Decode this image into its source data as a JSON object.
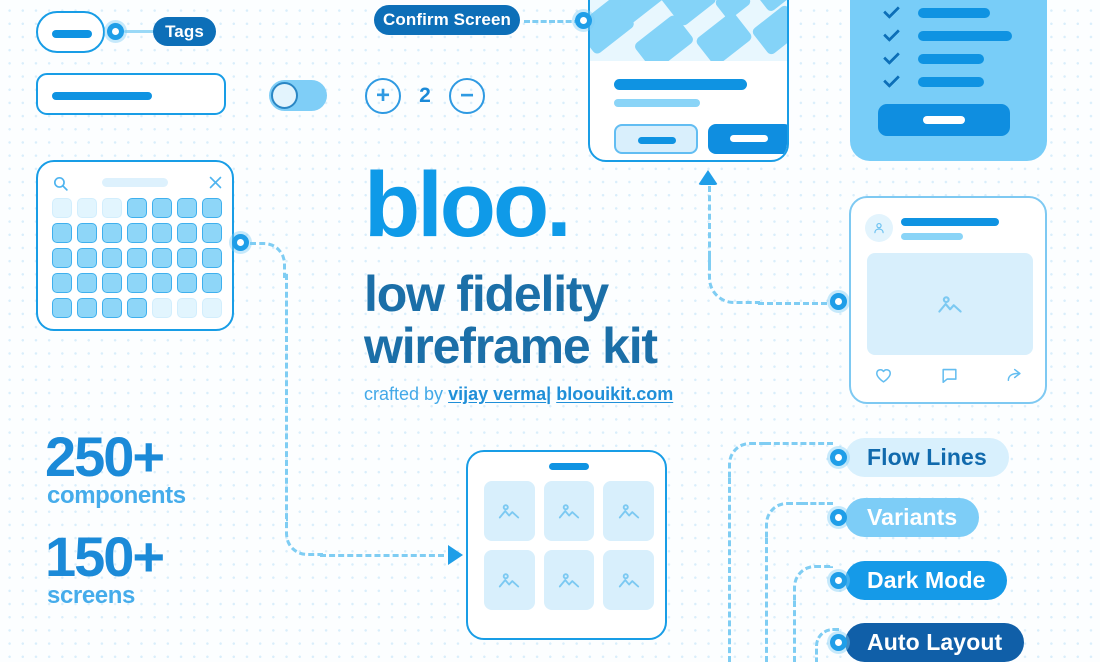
{
  "page": {
    "background": "#fcfeff",
    "accent_bright": "#0f9ae8",
    "accent_dark": "#1b6fa8",
    "accent_light": "#8ad4f7"
  },
  "brand": {
    "logo": "bloo.",
    "headline_line1": "low fidelity",
    "headline_line2": "wireframe kit",
    "credit_prefix": "crafted by",
    "credit_author": "vijay verma",
    "credit_separator": "|",
    "credit_site": "bloouikit.com"
  },
  "stats": [
    {
      "number": "250+",
      "label": "components"
    },
    {
      "number": "150+",
      "label": "screens"
    }
  ],
  "annotations": {
    "tags": "Tags",
    "confirm_screen": "Confirm Screen"
  },
  "feature_pills": [
    {
      "label": "Flow Lines",
      "style": "pale",
      "color": "#d8f0fd"
    },
    {
      "label": "Variants",
      "style": "mid",
      "color": "#7dcdf7"
    },
    {
      "label": "Dark Mode",
      "style": "bright",
      "color": "#159ae8"
    },
    {
      "label": "Auto Layout",
      "style": "navy",
      "color": "#105fa8"
    }
  ],
  "controls": {
    "toggle_state": "on",
    "stepper_increment": "+",
    "stepper_value": "2",
    "stepper_decrement": "−"
  },
  "picker_card": {
    "search_icon": "search-icon",
    "close_icon": "close-icon",
    "grid_rows": 5,
    "grid_cols": 7
  },
  "map_card": {
    "pin_icon": "map-pin-icon",
    "secondary_button": "",
    "primary_button": ""
  },
  "checklist_card": {
    "items": 4,
    "check_icon": "check-icon"
  },
  "post_card": {
    "avatar_icon": "user-avatar-icon",
    "image_icon": "image-placeholder-icon",
    "actions": [
      "heart-icon",
      "comment-icon",
      "share-icon"
    ]
  },
  "gallery_card": {
    "handle": "drag-handle",
    "tiles": 6,
    "tile_icon": "image-placeholder-icon"
  }
}
